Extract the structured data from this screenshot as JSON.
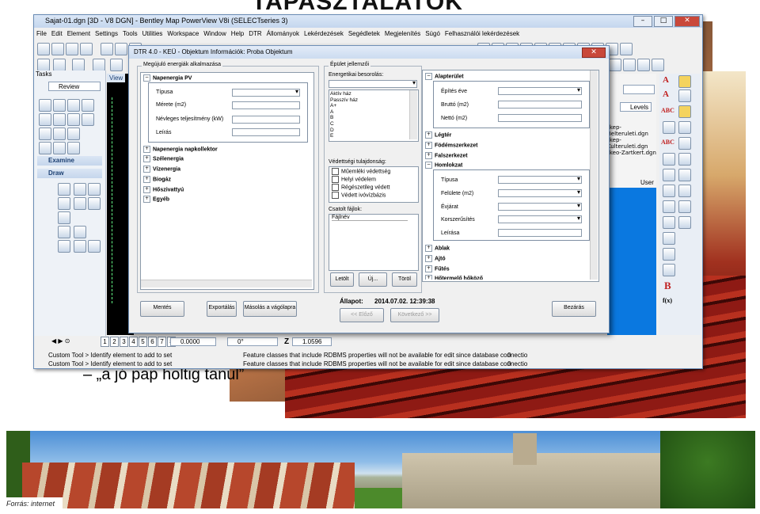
{
  "slide": {
    "title": "TAPASZTALATOK",
    "bullet": "–  „a jó pap holtig tanul”",
    "source": "Forrás: internet"
  },
  "window": {
    "title": "Sajat-01.dgn [3D - V8 DGN] - Bentley Map PowerView V8i (SELECTseries 3)",
    "menu": [
      "File",
      "Edit",
      "Element",
      "Settings",
      "Tools",
      "Utilities",
      "Workspace",
      "Window",
      "Help",
      "DTR",
      "Állományok",
      "Lekérdezések",
      "Segédletek",
      "Megjelenítés",
      "Súgó",
      "Felhasználói lekérdezések"
    ],
    "left_panel": {
      "tasks_label": "Tasks",
      "review": "Review",
      "examine": "Examine",
      "draw": "Draw"
    },
    "view_tab": "View",
    "right_list": [
      "rkep-Belteruleti.dgn",
      "rkep-Kulteruleti.dgn",
      "rkeo-Zartkert.dgn"
    ],
    "levels": "Levels",
    "user_label": "User",
    "view_buttons": [
      "1",
      "2",
      "3",
      "4",
      "5",
      "6",
      "7",
      "8"
    ],
    "coords": {
      "x": "0.0000",
      "angle": "0°",
      "z_label": "Z",
      "z": "1.0596"
    },
    "status": [
      "Custom Tool > Identify element to add to set",
      "Custom Tool > Identify element to add to set"
    ],
    "message": "Feature classes that include RDBMS properties will not be available for edit since database connectio",
    "status_zero": "0"
  },
  "dialog": {
    "title": "DTR 4.0 - KEÜ - Objektum Információk: Proba Objektum",
    "left_group": "Megújuló energiák alkalmazása",
    "tree_left": [
      "Napenergia PV",
      "Napenergia napkollektor",
      "Szélenergia",
      "Vízenergia",
      "Biogáz",
      "Hőszivattyú",
      "Egyéb"
    ],
    "pv_fields": [
      "Típusa",
      "Mérete (m2)",
      "Névleges teljesítmény (kW)",
      "Leírás"
    ],
    "mid_group": "Épület jellemzői",
    "energy_label": "Energetikai besorolás:",
    "energy_options": [
      "Aktív ház",
      "Passzív ház",
      "A+",
      "A",
      "B",
      "C",
      "D",
      "E"
    ],
    "protect_label": "Védettségi tulajdonság:",
    "protect_options": [
      "Műemléki védettség",
      "Helyi védelem",
      "Régészetileg védett",
      "Védett ivóvízbázis"
    ],
    "files_label": "Csatolt fájlok:",
    "files_col": "Fájlnév",
    "file_buttons": [
      "Letölt",
      "Új...",
      "Töröl"
    ],
    "tree_right": [
      "Alapterület",
      "Légtér",
      "Födémszerkezet",
      "Falszerkezet",
      "Homlokzat",
      "Ablak",
      "Ajtó",
      "Fűtés",
      "Hőtermelő hőköző"
    ],
    "alap_fields": [
      "Építés éve",
      "Bruttó (m2)",
      "Nettó (m2)"
    ],
    "homlok_fields": [
      "Típusa",
      "Felülete (m2)",
      "Évjárat",
      "Korszerűsítés",
      "Leírása"
    ],
    "buttons": {
      "save": "Mentés",
      "export": "Exportálás",
      "copy": "Másolás a vágólapra",
      "close": "Bezárás",
      "prev": "<< Előző",
      "next": "Következő >>"
    },
    "status_label": "Állapot:",
    "status_value": "2014.07.02. 12:39:38"
  },
  "right_tools": [
    "A",
    "A",
    "ABC",
    "ABC",
    "B",
    "f(x)"
  ]
}
